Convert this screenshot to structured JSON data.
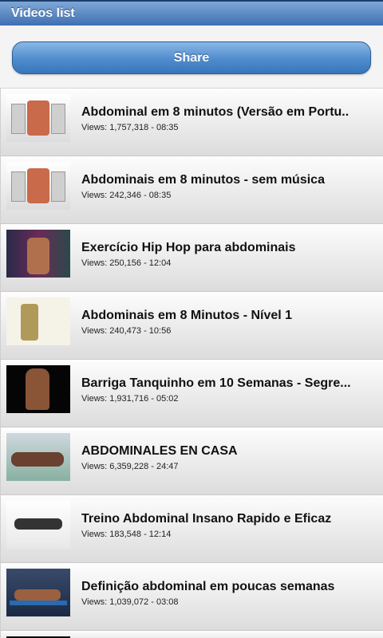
{
  "window": {
    "title": "Videos list"
  },
  "toolbar": {
    "share_label": "Share"
  },
  "videos": [
    {
      "title": "Abdominal em 8 minutos (Versão em Portu..",
      "meta": "Views: 1,757,318 - 08:35"
    },
    {
      "title": "Abdominais em 8 minutos - sem música",
      "meta": "Views: 242,346 - 08:35"
    },
    {
      "title": "Exercício Hip Hop para abdominais",
      "meta": "Views: 250,156 - 12:04"
    },
    {
      "title": "Abdominais em 8 Minutos - Nível 1",
      "meta": "Views: 240,473 - 10:56"
    },
    {
      "title": "Barriga Tanquinho em 10 Semanas - Segre...",
      "meta": "Views: 1,931,716 - 05:02"
    },
    {
      "title": "ABDOMINALES EN CASA",
      "meta": "Views: 6,359,228 - 24:47"
    },
    {
      "title": "Treino Abdominal Insano Rapido e Eficaz",
      "meta": "Views: 183,548 - 12:14"
    },
    {
      "title": "Definição abdominal em poucas semanas",
      "meta": "Views: 1,039,072 - 03:08"
    }
  ],
  "colors": {
    "titlebar": "#3d6fb2",
    "share_button": "#4f8ccc"
  }
}
